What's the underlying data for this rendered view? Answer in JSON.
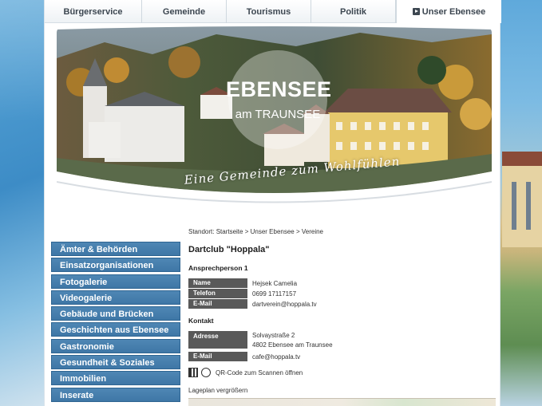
{
  "nav": {
    "tabs": [
      {
        "label": "Bürgerservice"
      },
      {
        "label": "Gemeinde"
      },
      {
        "label": "Tourismus"
      },
      {
        "label": "Politik"
      },
      {
        "label": "Unser Ebensee"
      }
    ]
  },
  "banner": {
    "title": "EBENSEE",
    "subtitle": "am TRAUNSEE",
    "slogan": "Eine Gemeinde zum Wohlfühlen"
  },
  "sidebar": {
    "items": [
      {
        "label": "Ämter & Behörden"
      },
      {
        "label": "Einsatzorganisationen"
      },
      {
        "label": "Fotogalerie"
      },
      {
        "label": "Videogalerie"
      },
      {
        "label": "Gebäude und Brücken"
      },
      {
        "label": "Geschichten aus Ebensee"
      },
      {
        "label": "Gastronomie"
      },
      {
        "label": "Gesundheit & Soziales"
      },
      {
        "label": "Immobilien"
      },
      {
        "label": "Inserate"
      }
    ]
  },
  "content": {
    "breadcrumb": "Standort: Startseite > Unser Ebensee > Vereine",
    "title": "Dartclub \"Hoppala\"",
    "contact_person_heading": "Ansprechperson 1",
    "person": {
      "name_label": "Name",
      "name_value": "Hejsek Camelia",
      "phone_label": "Telefon",
      "phone_value": "0699 17117157",
      "email_label": "E-Mail",
      "email_value": "dartverein@hoppala.tv"
    },
    "contact_heading": "Kontakt",
    "contact": {
      "address_label": "Adresse",
      "address_line1": "Solvaystraße 2",
      "address_line2": "4802 Ebensee am Traunsee",
      "email_label": "E-Mail",
      "email_value": "cafe@hoppala.tv"
    },
    "qr_text": "QR-Code zum Scannen öffnen",
    "map_link": "Lageplan vergrößern"
  },
  "colors": {
    "sidebar_bg": "#4a82b0",
    "label_bg": "#595959"
  }
}
